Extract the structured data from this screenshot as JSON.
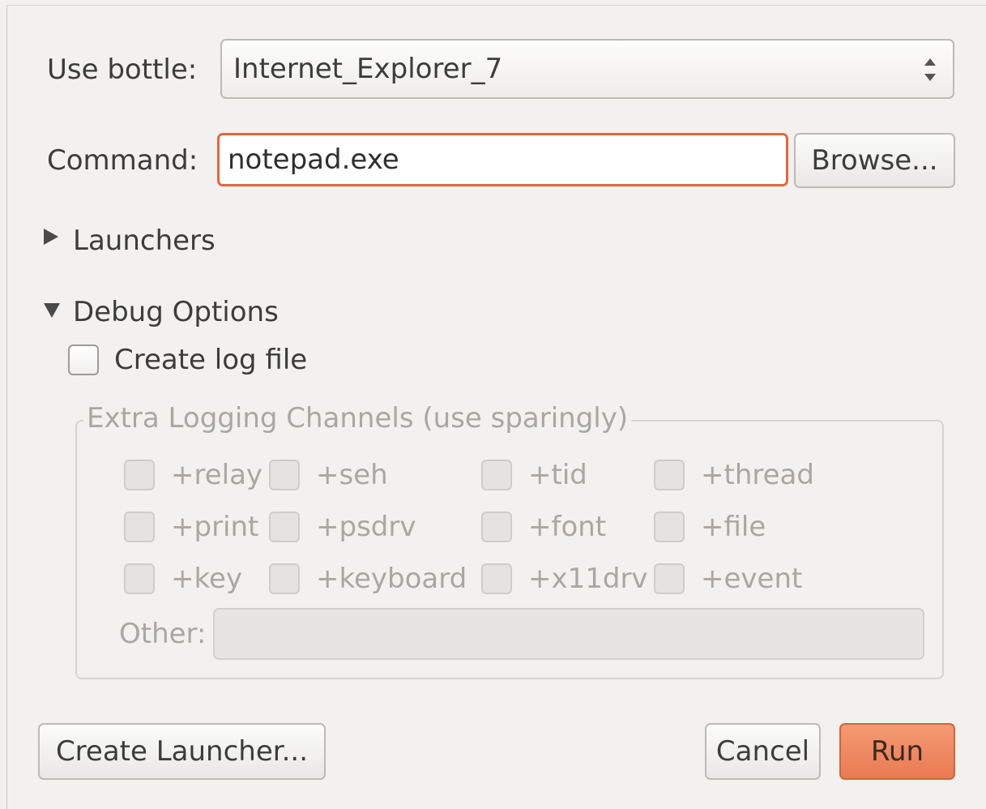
{
  "dialog": {
    "bottle_label": "Use bottle:",
    "bottle_value": "Internet_Explorer_7",
    "command_label": "Command:",
    "command_value": "notepad.exe",
    "browse_label": "Browse...",
    "launchers_label": "Launchers",
    "debug_label": "Debug Options",
    "create_log_label": "Create log file",
    "extra_channels_legend": "Extra Logging Channels (use sparingly)",
    "channels": [
      [
        "+relay",
        "+seh",
        "+tid",
        "+thread"
      ],
      [
        "+print",
        "+psdrv",
        "+font",
        "+file"
      ],
      [
        "+key",
        "+keyboard",
        "+x11drv",
        "+event"
      ]
    ],
    "other_label": "Other:",
    "other_value": "",
    "create_launcher_label": "Create Launcher...",
    "cancel_label": "Cancel",
    "run_label": "Run"
  },
  "colors": {
    "accent": "#ea7a52",
    "focus_border": "#e2673d",
    "background": "#f2f1f0",
    "disabled_text": "#aaa7a3"
  }
}
